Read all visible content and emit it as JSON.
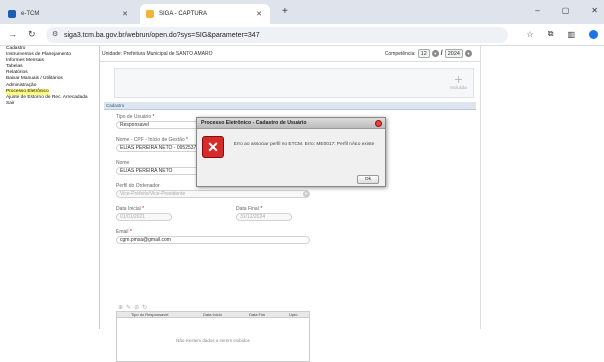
{
  "browser": {
    "tabs": [
      {
        "label": "e-TCM",
        "active": false
      },
      {
        "label": "SIGA - CAPTURA",
        "active": true
      }
    ],
    "new_tab": "+",
    "address": "siga3.tcm.ba.gov.br/webrun/open.do?sys=SIG&parameter=347",
    "window_controls": [
      "–",
      "▢",
      "✕"
    ]
  },
  "menu": {
    "items": [
      {
        "label": "Cadastro",
        "selected": false
      },
      {
        "label": "Instrumentos de Planejamento",
        "selected": false
      },
      {
        "label": "Informes Mensais",
        "selected": false
      },
      {
        "label": "Tabelas",
        "selected": false
      },
      {
        "label": "Relatórios",
        "selected": false
      },
      {
        "label": "Baixar Manuais / Utilitários",
        "selected": false
      },
      {
        "label": "Administração",
        "selected": false
      },
      {
        "label": "Processo Eletrônico",
        "selected": true
      },
      {
        "label": "Ajuste de Estorno de Rec. Arrecadada",
        "selected": false
      },
      {
        "label": "Sair",
        "selected": false
      }
    ]
  },
  "header": {
    "unit": "Unidade: Prefeitura Municipal de SANTO AMARO",
    "competencia_label": "Competência:",
    "month": "12",
    "separator": "/",
    "year": "2024"
  },
  "toolbar": {
    "incluir_label": "Inclusão",
    "plus": "+"
  },
  "cadastro_tab": "Cadastro",
  "form": {
    "tipo_usuario_label": "Tipo de Usuário",
    "tipo_usuario_value": "Responsavel",
    "nome_cpf_label": "Nome - CPF - Início de Gestão",
    "nome_cpf_value": "ELIAS PEREIRA NETO - 09525378500 - 01/01/2021",
    "nome_label": "Nome",
    "nome_value": "ELIAS PEREIRA NETO",
    "perfil_label": "Perfil do Ordenador",
    "perfil_value": "Vice-Prefeito/Vice-Presidente",
    "data_inicial_label": "Data Inicial",
    "data_inicial_value": "01/01/2021",
    "data_final_label": "Data Final",
    "data_final_value": "31/12/2024",
    "email_label": "Email",
    "email_value": "cgm.pmsa@gmail.com",
    "required_mark": "*"
  },
  "grid": {
    "columns": [
      "Tipo do Responsavel",
      "Data Inicio",
      "Data Fim",
      "Upto"
    ],
    "empty_text": "Não existem dados a serem exibidos"
  },
  "dialog": {
    "title": "Processo Eletrônico - Cadastro de Usuário",
    "message": "Erro ao associar perfil no ETCM. Erro: ME0017: Perfil nÃ£o existe",
    "ok_label": "Ok",
    "icon": "error-x-icon"
  }
}
